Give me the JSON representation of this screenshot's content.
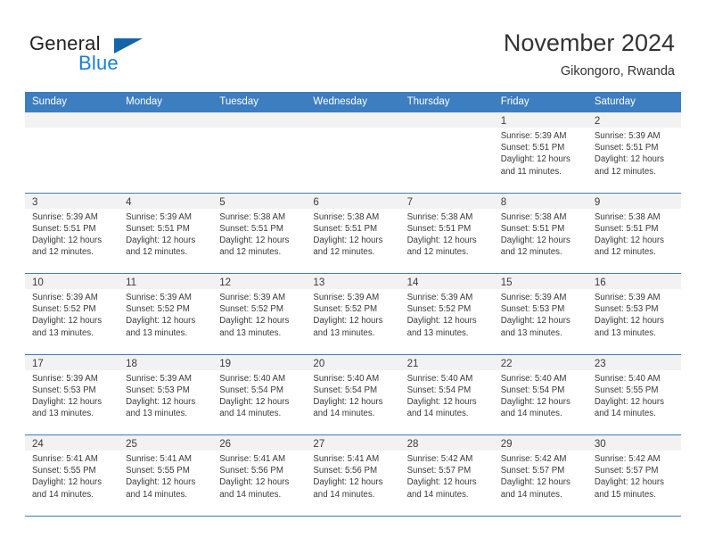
{
  "brand": {
    "name_part1": "General",
    "name_part2": "Blue",
    "triangle_color": "#1464aa",
    "blue_color": "#1a7fd4"
  },
  "header": {
    "title": "November 2024",
    "subtitle": "Gikongoro, Rwanda"
  },
  "theme": {
    "header_bg": "#3c7ebf",
    "day_band_bg": "#f2f2f2",
    "text_color": "#3a3a3a"
  },
  "weekdays": [
    "Sunday",
    "Monday",
    "Tuesday",
    "Wednesday",
    "Thursday",
    "Friday",
    "Saturday"
  ],
  "weeks": [
    [
      {
        "empty": true
      },
      {
        "empty": true
      },
      {
        "empty": true
      },
      {
        "empty": true
      },
      {
        "empty": true
      },
      {
        "day": "1",
        "sunrise": "Sunrise: 5:39 AM",
        "sunset": "Sunset: 5:51 PM",
        "daylight1": "Daylight: 12 hours",
        "daylight2": "and 11 minutes."
      },
      {
        "day": "2",
        "sunrise": "Sunrise: 5:39 AM",
        "sunset": "Sunset: 5:51 PM",
        "daylight1": "Daylight: 12 hours",
        "daylight2": "and 12 minutes."
      }
    ],
    [
      {
        "day": "3",
        "sunrise": "Sunrise: 5:39 AM",
        "sunset": "Sunset: 5:51 PM",
        "daylight1": "Daylight: 12 hours",
        "daylight2": "and 12 minutes."
      },
      {
        "day": "4",
        "sunrise": "Sunrise: 5:39 AM",
        "sunset": "Sunset: 5:51 PM",
        "daylight1": "Daylight: 12 hours",
        "daylight2": "and 12 minutes."
      },
      {
        "day": "5",
        "sunrise": "Sunrise: 5:38 AM",
        "sunset": "Sunset: 5:51 PM",
        "daylight1": "Daylight: 12 hours",
        "daylight2": "and 12 minutes."
      },
      {
        "day": "6",
        "sunrise": "Sunrise: 5:38 AM",
        "sunset": "Sunset: 5:51 PM",
        "daylight1": "Daylight: 12 hours",
        "daylight2": "and 12 minutes."
      },
      {
        "day": "7",
        "sunrise": "Sunrise: 5:38 AM",
        "sunset": "Sunset: 5:51 PM",
        "daylight1": "Daylight: 12 hours",
        "daylight2": "and 12 minutes."
      },
      {
        "day": "8",
        "sunrise": "Sunrise: 5:38 AM",
        "sunset": "Sunset: 5:51 PM",
        "daylight1": "Daylight: 12 hours",
        "daylight2": "and 12 minutes."
      },
      {
        "day": "9",
        "sunrise": "Sunrise: 5:38 AM",
        "sunset": "Sunset: 5:51 PM",
        "daylight1": "Daylight: 12 hours",
        "daylight2": "and 12 minutes."
      }
    ],
    [
      {
        "day": "10",
        "sunrise": "Sunrise: 5:39 AM",
        "sunset": "Sunset: 5:52 PM",
        "daylight1": "Daylight: 12 hours",
        "daylight2": "and 13 minutes."
      },
      {
        "day": "11",
        "sunrise": "Sunrise: 5:39 AM",
        "sunset": "Sunset: 5:52 PM",
        "daylight1": "Daylight: 12 hours",
        "daylight2": "and 13 minutes."
      },
      {
        "day": "12",
        "sunrise": "Sunrise: 5:39 AM",
        "sunset": "Sunset: 5:52 PM",
        "daylight1": "Daylight: 12 hours",
        "daylight2": "and 13 minutes."
      },
      {
        "day": "13",
        "sunrise": "Sunrise: 5:39 AM",
        "sunset": "Sunset: 5:52 PM",
        "daylight1": "Daylight: 12 hours",
        "daylight2": "and 13 minutes."
      },
      {
        "day": "14",
        "sunrise": "Sunrise: 5:39 AM",
        "sunset": "Sunset: 5:52 PM",
        "daylight1": "Daylight: 12 hours",
        "daylight2": "and 13 minutes."
      },
      {
        "day": "15",
        "sunrise": "Sunrise: 5:39 AM",
        "sunset": "Sunset: 5:53 PM",
        "daylight1": "Daylight: 12 hours",
        "daylight2": "and 13 minutes."
      },
      {
        "day": "16",
        "sunrise": "Sunrise: 5:39 AM",
        "sunset": "Sunset: 5:53 PM",
        "daylight1": "Daylight: 12 hours",
        "daylight2": "and 13 minutes."
      }
    ],
    [
      {
        "day": "17",
        "sunrise": "Sunrise: 5:39 AM",
        "sunset": "Sunset: 5:53 PM",
        "daylight1": "Daylight: 12 hours",
        "daylight2": "and 13 minutes."
      },
      {
        "day": "18",
        "sunrise": "Sunrise: 5:39 AM",
        "sunset": "Sunset: 5:53 PM",
        "daylight1": "Daylight: 12 hours",
        "daylight2": "and 13 minutes."
      },
      {
        "day": "19",
        "sunrise": "Sunrise: 5:40 AM",
        "sunset": "Sunset: 5:54 PM",
        "daylight1": "Daylight: 12 hours",
        "daylight2": "and 14 minutes."
      },
      {
        "day": "20",
        "sunrise": "Sunrise: 5:40 AM",
        "sunset": "Sunset: 5:54 PM",
        "daylight1": "Daylight: 12 hours",
        "daylight2": "and 14 minutes."
      },
      {
        "day": "21",
        "sunrise": "Sunrise: 5:40 AM",
        "sunset": "Sunset: 5:54 PM",
        "daylight1": "Daylight: 12 hours",
        "daylight2": "and 14 minutes."
      },
      {
        "day": "22",
        "sunrise": "Sunrise: 5:40 AM",
        "sunset": "Sunset: 5:54 PM",
        "daylight1": "Daylight: 12 hours",
        "daylight2": "and 14 minutes."
      },
      {
        "day": "23",
        "sunrise": "Sunrise: 5:40 AM",
        "sunset": "Sunset: 5:55 PM",
        "daylight1": "Daylight: 12 hours",
        "daylight2": "and 14 minutes."
      }
    ],
    [
      {
        "day": "24",
        "sunrise": "Sunrise: 5:41 AM",
        "sunset": "Sunset: 5:55 PM",
        "daylight1": "Daylight: 12 hours",
        "daylight2": "and 14 minutes."
      },
      {
        "day": "25",
        "sunrise": "Sunrise: 5:41 AM",
        "sunset": "Sunset: 5:55 PM",
        "daylight1": "Daylight: 12 hours",
        "daylight2": "and 14 minutes."
      },
      {
        "day": "26",
        "sunrise": "Sunrise: 5:41 AM",
        "sunset": "Sunset: 5:56 PM",
        "daylight1": "Daylight: 12 hours",
        "daylight2": "and 14 minutes."
      },
      {
        "day": "27",
        "sunrise": "Sunrise: 5:41 AM",
        "sunset": "Sunset: 5:56 PM",
        "daylight1": "Daylight: 12 hours",
        "daylight2": "and 14 minutes."
      },
      {
        "day": "28",
        "sunrise": "Sunrise: 5:42 AM",
        "sunset": "Sunset: 5:57 PM",
        "daylight1": "Daylight: 12 hours",
        "daylight2": "and 14 minutes."
      },
      {
        "day": "29",
        "sunrise": "Sunrise: 5:42 AM",
        "sunset": "Sunset: 5:57 PM",
        "daylight1": "Daylight: 12 hours",
        "daylight2": "and 14 minutes."
      },
      {
        "day": "30",
        "sunrise": "Sunrise: 5:42 AM",
        "sunset": "Sunset: 5:57 PM",
        "daylight1": "Daylight: 12 hours",
        "daylight2": "and 15 minutes."
      }
    ]
  ]
}
